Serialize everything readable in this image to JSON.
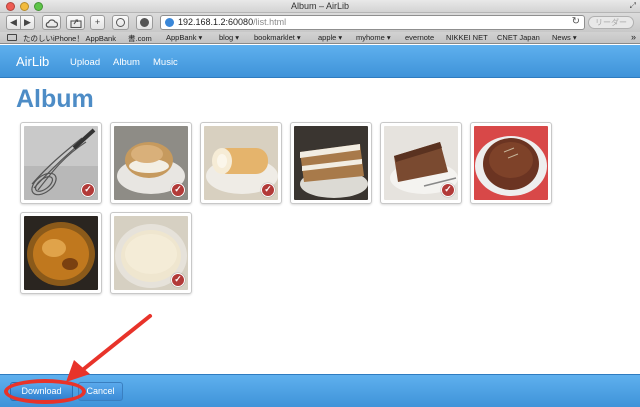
{
  "window": {
    "title": "Album – AirLib"
  },
  "toolbar": {
    "back_icon": "◀",
    "forward_icon": "▶",
    "add_icon": "+",
    "url_host": "192.168.1.2:60080",
    "url_path": "/list.html",
    "reload_icon": "↻",
    "reader_label": "リーダー"
  },
  "bookmarks": [
    {
      "label": "たのしいiPhone！ AppBank"
    },
    {
      "label": "書.com"
    },
    {
      "label": "AppBank ▾"
    },
    {
      "label": "blog ▾"
    },
    {
      "label": "bookmarklet ▾"
    },
    {
      "label": "apple ▾"
    },
    {
      "label": "myhome ▾"
    },
    {
      "label": "evernote"
    },
    {
      "label": "NIKKEI NET"
    },
    {
      "label": "CNET Japan"
    },
    {
      "label": "News ▾"
    }
  ],
  "bookmarks_more": "»",
  "nav": {
    "brand": "AirLib",
    "links": [
      "Upload",
      "Album",
      "Music"
    ]
  },
  "page": {
    "title": "Album"
  },
  "album": {
    "check_glyph": "✓",
    "photos": [
      {
        "subject": "wire whisk",
        "selected": true
      },
      {
        "subject": "cream puff",
        "selected": true
      },
      {
        "subject": "roll cake",
        "selected": true
      },
      {
        "subject": "layer cake slice",
        "selected": false
      },
      {
        "subject": "chocolate cake slice",
        "selected": true
      },
      {
        "subject": "chocolate cake",
        "selected": false
      },
      {
        "subject": "creme brulee",
        "selected": false
      },
      {
        "subject": "panna cotta",
        "selected": true
      }
    ]
  },
  "footer": {
    "download_label": "Download",
    "cancel_label": "Cancel"
  },
  "colors": {
    "nav_blue": "#4a9de2",
    "title_blue": "#4d8cc6",
    "check_red": "#b23a38",
    "annotation_red": "#e8332a"
  }
}
